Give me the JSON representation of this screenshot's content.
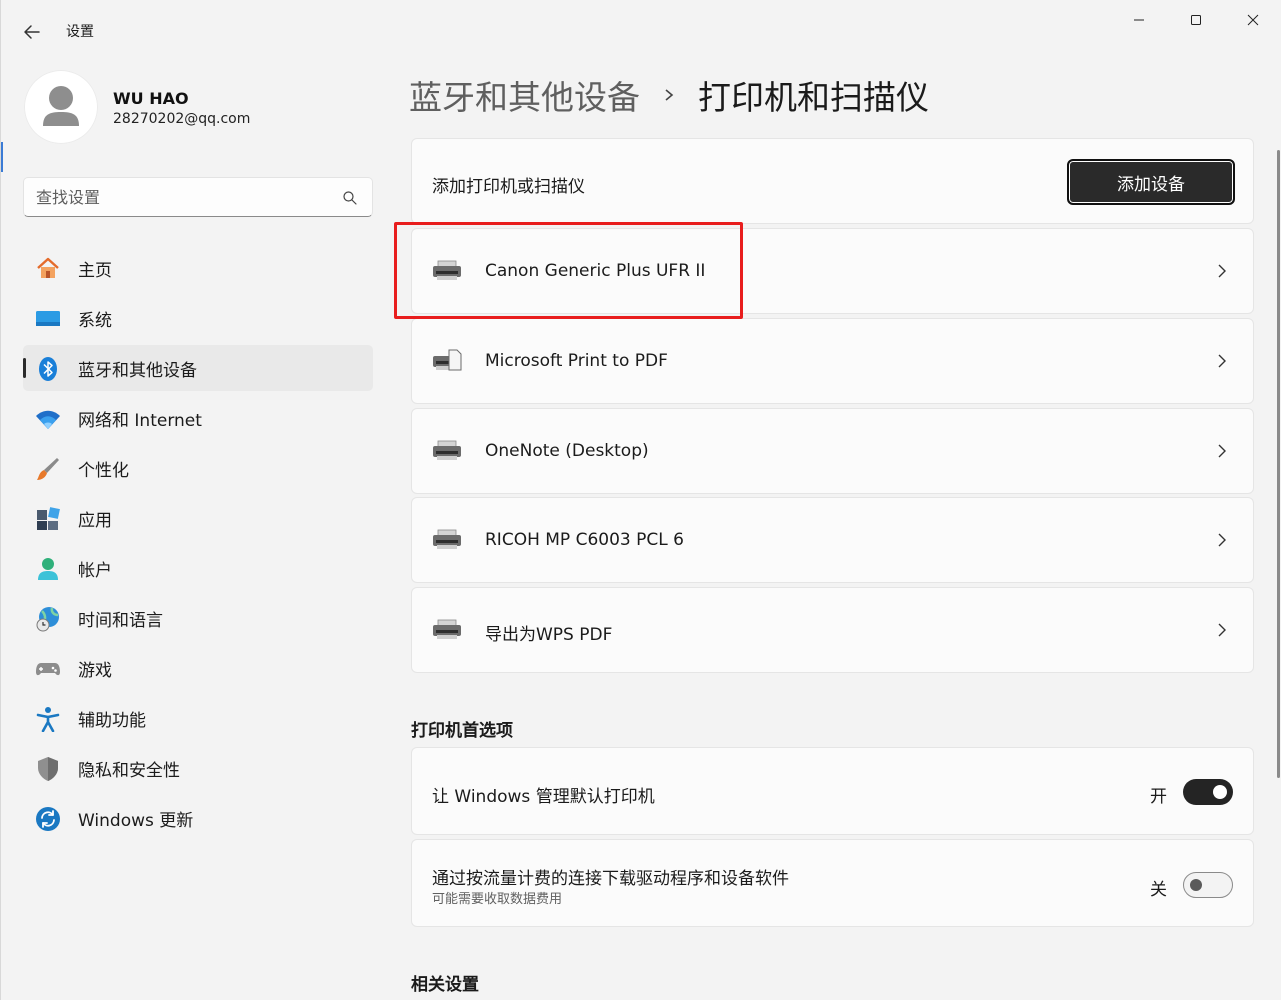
{
  "window": {
    "title": "设置"
  },
  "profile": {
    "name": "WU HAO",
    "email": "28270202@qq.com"
  },
  "search": {
    "placeholder": "查找设置"
  },
  "sidebar": {
    "items": [
      {
        "label": "主页",
        "icon": "home-icon"
      },
      {
        "label": "系统",
        "icon": "system-icon"
      },
      {
        "label": "蓝牙和其他设备",
        "icon": "bluetooth-icon",
        "active": true
      },
      {
        "label": "网络和 Internet",
        "icon": "wifi-icon"
      },
      {
        "label": "个性化",
        "icon": "brush-icon"
      },
      {
        "label": "应用",
        "icon": "apps-icon"
      },
      {
        "label": "帐户",
        "icon": "account-icon"
      },
      {
        "label": "时间和语言",
        "icon": "globe-clock-icon"
      },
      {
        "label": "游戏",
        "icon": "gamepad-icon"
      },
      {
        "label": "辅助功能",
        "icon": "accessibility-icon"
      },
      {
        "label": "隐私和安全性",
        "icon": "shield-icon"
      },
      {
        "label": "Windows 更新",
        "icon": "update-icon"
      }
    ]
  },
  "breadcrumb": {
    "parent": "蓝牙和其他设备",
    "current": "打印机和扫描仪"
  },
  "add_printer": {
    "label": "添加打印机或扫描仪",
    "button_label": "添加设备"
  },
  "printers": [
    {
      "name": "Canon Generic Plus UFR II",
      "icon": "printer-icon"
    },
    {
      "name": "Microsoft Print to PDF",
      "icon": "pdf-printer-icon"
    },
    {
      "name": "OneNote (Desktop)",
      "icon": "printer-icon"
    },
    {
      "name": "RICOH MP C6003 PCL 6",
      "icon": "printer-icon"
    },
    {
      "name": "导出为WPS PDF",
      "icon": "printer-icon"
    }
  ],
  "preferences": {
    "title": "打印机首选项",
    "items": [
      {
        "label": "让 Windows 管理默认打印机",
        "state_label": "开",
        "on": true
      },
      {
        "label": "通过按流量计费的连接下载驱动程序和设备软件",
        "sublabel": "可能需要收取数据费用",
        "state_label": "关",
        "on": false
      }
    ]
  },
  "related": {
    "title": "相关设置"
  },
  "colors": {
    "accent": "#0067c0",
    "highlight": "#e81d1d"
  }
}
